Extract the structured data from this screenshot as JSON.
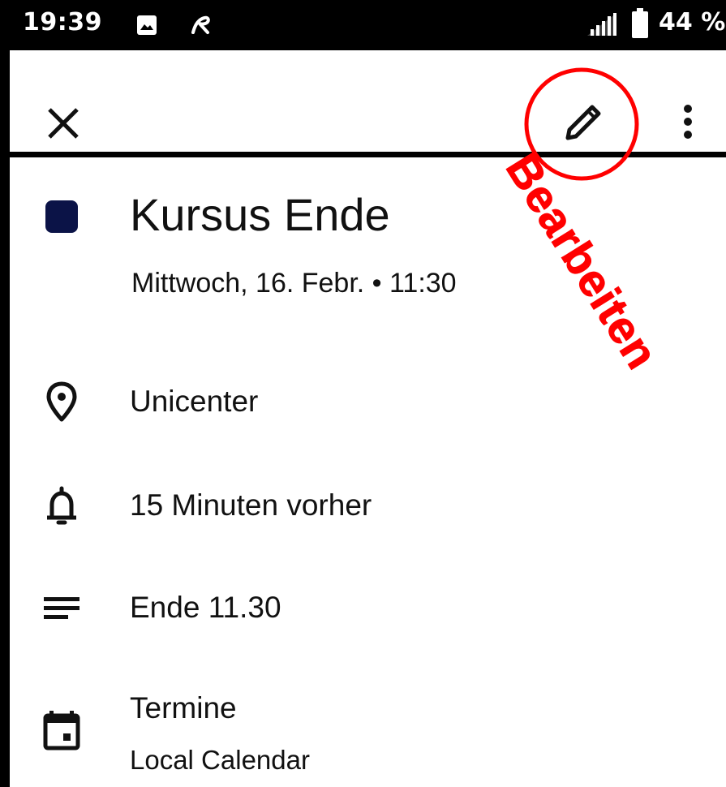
{
  "status_bar": {
    "time": "19:39",
    "battery": "44 %",
    "icons": [
      "image-icon",
      "app-notification-icon",
      "signal-icon",
      "battery-icon"
    ]
  },
  "toolbar": {
    "icons": [
      "close-icon",
      "edit-pencil-icon",
      "more-vert-icon"
    ]
  },
  "annotation": {
    "label": "Bearbeiten",
    "color": "#ff0000"
  },
  "event": {
    "title": "Kursus Ende",
    "datetime": "Mittwoch, 16. Febr. • 11:30",
    "color": "#0b1347",
    "location": "Unicenter",
    "reminder": "15 Minuten vorher",
    "description": "Ende 11.30",
    "calendar_name": "Termine",
    "calendar_account": "Local Calendar"
  },
  "colors": {
    "status_bar_bg": "#000000",
    "background": "#ffffff",
    "text": "#111111"
  }
}
